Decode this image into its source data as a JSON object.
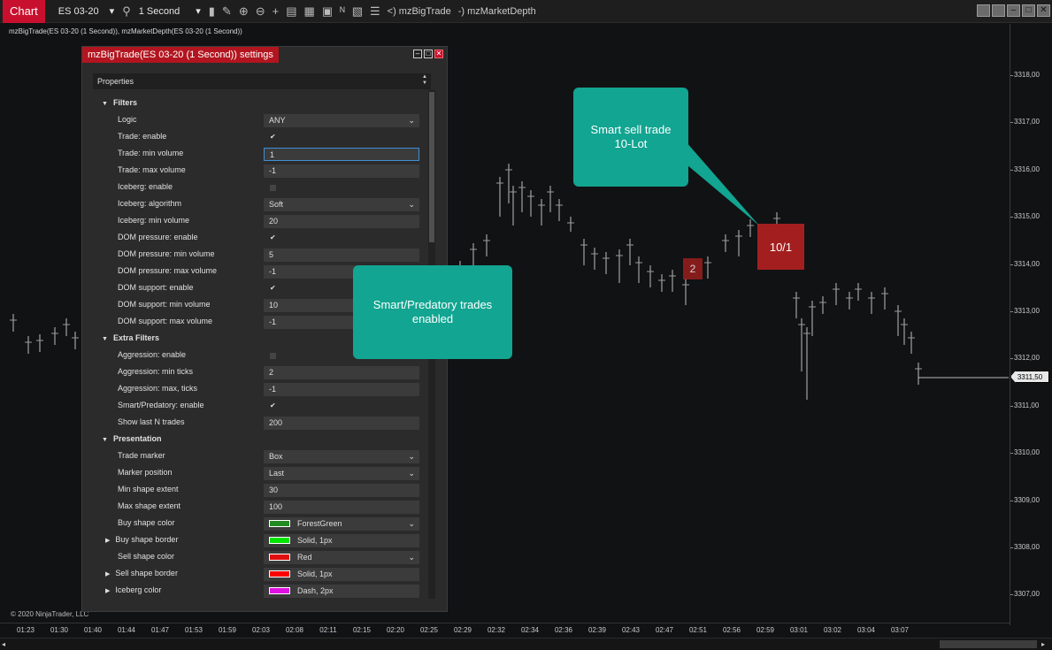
{
  "toolbar": {
    "tab": "Chart",
    "instrument": "ES 03-20",
    "interval": "1 Second",
    "indicators": [
      "<) mzBigTrade",
      "-) mzMarketDepth"
    ]
  },
  "chart": {
    "indicator_label": "mzBigTrade(ES 03-20 (1 Second)), mzMarketDepth(ES 03-20 (1 Second))",
    "copyright": "© 2020 NinjaTrader, LLC",
    "price_labels": [
      "3318,00",
      "3317,00",
      "3316,00",
      "3315,00",
      "3314,00",
      "3313,00",
      "3312,00",
      "3311,00",
      "3310,00",
      "3309,00",
      "3308,00",
      "3307,00"
    ],
    "last_price": "3311,50",
    "time_labels": [
      "01:23",
      "01:30",
      "01:40",
      "01:44",
      "01:47",
      "01:53",
      "01:59",
      "02:03",
      "02:08",
      "02:11",
      "02:15",
      "02:20",
      "02:25",
      "02:29",
      "02:32",
      "02:34",
      "02:36",
      "02:39",
      "02:43",
      "02:47",
      "02:51",
      "02:56",
      "02:59",
      "03:01",
      "03:02",
      "03:04",
      "03:07"
    ],
    "markers": {
      "small": "2",
      "large": "10/1"
    },
    "colors": {
      "marker": "#a31f1f",
      "callout": "#12a591",
      "tab": "#c8102e"
    }
  },
  "callouts": {
    "sell": "Smart sell trade\n10-Lot",
    "predatory": "Smart/Predatory trades\nenabled"
  },
  "dialog": {
    "title": "mzBigTrade(ES 03-20 (1 Second)) settings",
    "properties_header": "Properties",
    "rows": [
      {
        "type": "cat",
        "label": "Filters"
      },
      {
        "type": "select",
        "label": "Logic",
        "value": "ANY"
      },
      {
        "type": "check",
        "label": "Trade: enable",
        "checked": true
      },
      {
        "type": "text",
        "label": "Trade: min volume",
        "value": "1",
        "active": true
      },
      {
        "type": "text",
        "label": "Trade: max volume",
        "value": "-1"
      },
      {
        "type": "check",
        "label": "Iceberg: enable",
        "checked": false
      },
      {
        "type": "select",
        "label": "Iceberg: algorithm",
        "value": "Soft"
      },
      {
        "type": "text",
        "label": "Iceberg: min volume",
        "value": "20"
      },
      {
        "type": "check",
        "label": "DOM pressure: enable",
        "checked": true
      },
      {
        "type": "text",
        "label": "DOM pressure: min volume",
        "value": "5"
      },
      {
        "type": "text",
        "label": "DOM pressure: max volume",
        "value": "-1"
      },
      {
        "type": "check",
        "label": "DOM support: enable",
        "checked": true
      },
      {
        "type": "text",
        "label": "DOM support: min volume",
        "value": "10"
      },
      {
        "type": "text",
        "label": "DOM support: max volume",
        "value": "-1"
      },
      {
        "type": "cat",
        "label": "Extra Filters"
      },
      {
        "type": "check",
        "label": "Aggression: enable",
        "checked": false
      },
      {
        "type": "text",
        "label": "Aggression: min ticks",
        "value": "2"
      },
      {
        "type": "text",
        "label": "Aggression: max, ticks",
        "value": "-1"
      },
      {
        "type": "check",
        "label": "Smart/Predatory: enable",
        "checked": true
      },
      {
        "type": "text",
        "label": "Show last N trades",
        "value": "200"
      },
      {
        "type": "cat",
        "label": "Presentation"
      },
      {
        "type": "select",
        "label": "Trade marker",
        "value": "Box"
      },
      {
        "type": "select",
        "label": "Marker position",
        "value": "Last"
      },
      {
        "type": "text",
        "label": "Min shape extent",
        "value": "30"
      },
      {
        "type": "text",
        "label": "Max shape extent",
        "value": "100"
      },
      {
        "type": "color",
        "label": "Buy shape color",
        "value": "ForestGreen",
        "swatch": "#228b22",
        "select": true
      },
      {
        "type": "color",
        "label": "Buy shape border",
        "value": "Solid, 1px",
        "swatch": "#00e600",
        "expand": true
      },
      {
        "type": "color",
        "label": "Sell shape color",
        "value": "Red",
        "swatch": "#e01010",
        "select": true
      },
      {
        "type": "color",
        "label": "Sell shape border",
        "value": "Solid, 1px",
        "swatch": "#ff0000",
        "expand": true
      },
      {
        "type": "color",
        "label": "Iceberg color",
        "value": "Dash, 2px",
        "swatch": "#e010e0",
        "expand": true
      }
    ]
  }
}
